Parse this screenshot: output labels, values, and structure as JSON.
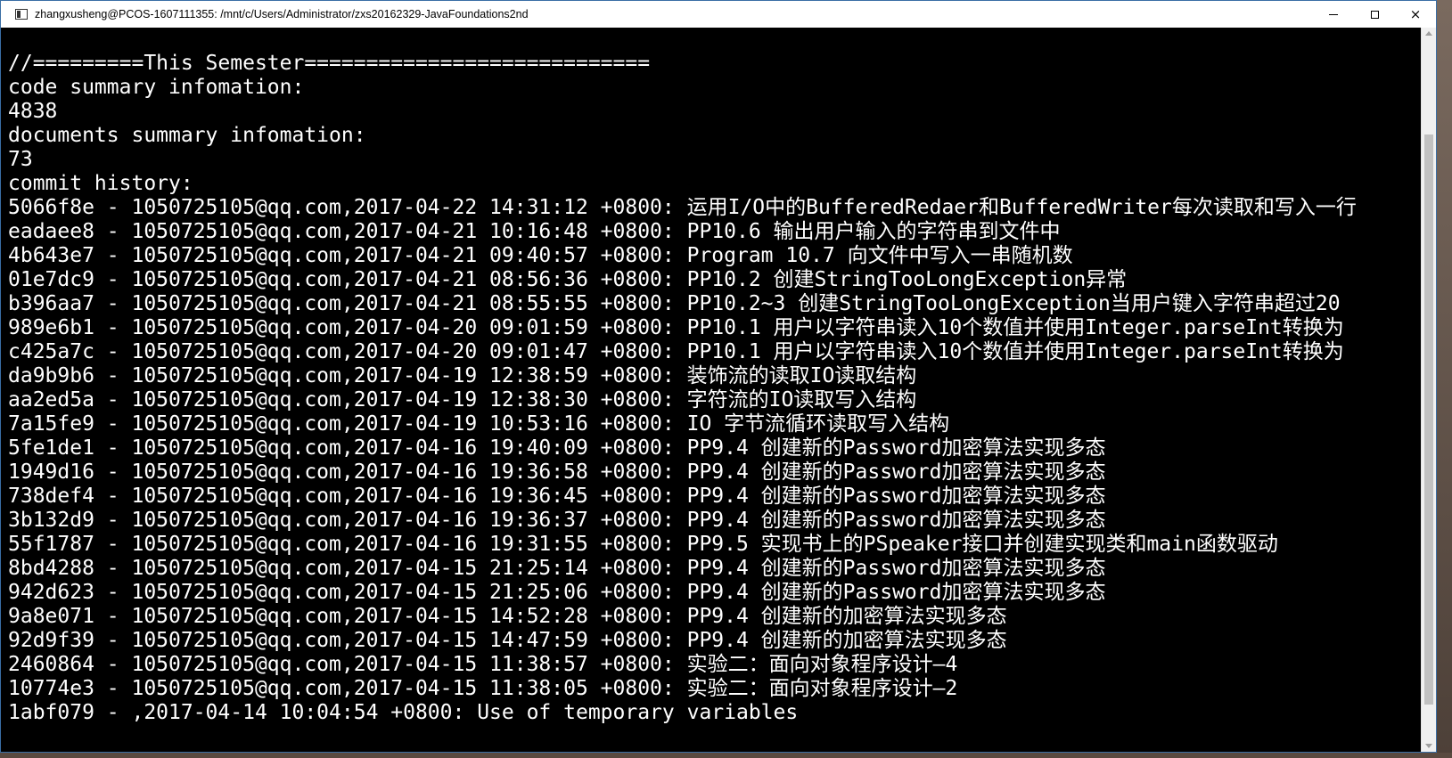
{
  "window": {
    "title": "zhangxusheng@PCOS-1607111355: /mnt/c/Users/Administrator/zxs20162329-JavaFoundations2nd",
    "controls": {
      "minimize": "minimize",
      "maximize": "maximize",
      "close": "×"
    }
  },
  "terminal": {
    "lines": [
      "//=========This Semester============================",
      "code summary infomation:",
      "4838",
      "documents summary infomation:",
      "73",
      "commit history:",
      "5066f8e - 1050725105@qq.com,2017-04-22 14:31:12 +0800: 运用I/O中的BufferedRedaer和BufferedWriter每次读取和写入一行",
      "eadaee8 - 1050725105@qq.com,2017-04-21 10:16:48 +0800: PP10.6 输出用户输入的字符串到文件中",
      "4b643e7 - 1050725105@qq.com,2017-04-21 09:40:57 +0800: Program 10.7 向文件中写入一串随机数",
      "01e7dc9 - 1050725105@qq.com,2017-04-21 08:56:36 +0800: PP10.2 创建StringTooLongException异常",
      "b396aa7 - 1050725105@qq.com,2017-04-21 08:55:55 +0800: PP10.2~3 创建StringTooLongException当用户键入字符串超过20",
      "989e6b1 - 1050725105@qq.com,2017-04-20 09:01:59 +0800: PP10.1 用户以字符串读入10个数值并使用Integer.parseInt转换为",
      "c425a7c - 1050725105@qq.com,2017-04-20 09:01:47 +0800: PP10.1 用户以字符串读入10个数值并使用Integer.parseInt转换为",
      "da9b9b6 - 1050725105@qq.com,2017-04-19 12:38:59 +0800: 装饰流的读取IO读取结构",
      "aa2ed5a - 1050725105@qq.com,2017-04-19 12:38:30 +0800: 字符流的IO读取写入结构",
      "7a15fe9 - 1050725105@qq.com,2017-04-19 10:53:16 +0800: IO 字节流循环读取写入结构",
      "5fe1de1 - 1050725105@qq.com,2017-04-16 19:40:09 +0800: PP9.4 创建新的Password加密算法实现多态",
      "1949d16 - 1050725105@qq.com,2017-04-16 19:36:58 +0800: PP9.4 创建新的Password加密算法实现多态",
      "738def4 - 1050725105@qq.com,2017-04-16 19:36:45 +0800: PP9.4 创建新的Password加密算法实现多态",
      "3b132d9 - 1050725105@qq.com,2017-04-16 19:36:37 +0800: PP9.4 创建新的Password加密算法实现多态",
      "55f1787 - 1050725105@qq.com,2017-04-16 19:31:55 +0800: PP9.5 实现书上的PSpeaker接口并创建实现类和main函数驱动",
      "8bd4288 - 1050725105@qq.com,2017-04-15 21:25:14 +0800: PP9.4 创建新的Password加密算法实现多态",
      "942d623 - 1050725105@qq.com,2017-04-15 21:25:06 +0800: PP9.4 创建新的Password加密算法实现多态",
      "9a8e071 - 1050725105@qq.com,2017-04-15 14:52:28 +0800: PP9.4 创建新的加密算法实现多态",
      "92d9f39 - 1050725105@qq.com,2017-04-15 14:47:59 +0800: PP9.4 创建新的加密算法实现多态",
      "2460864 - 1050725105@qq.com,2017-04-15 11:38:57 +0800: 实验二：面向对象程序设计—4",
      "10774e3 - 1050725105@qq.com,2017-04-15 11:38:05 +0800: 实验二：面向对象程序设计—2",
      "1abf079 - ,2017-04-14 10:04:54 +0800: Use of temporary variables"
    ]
  }
}
